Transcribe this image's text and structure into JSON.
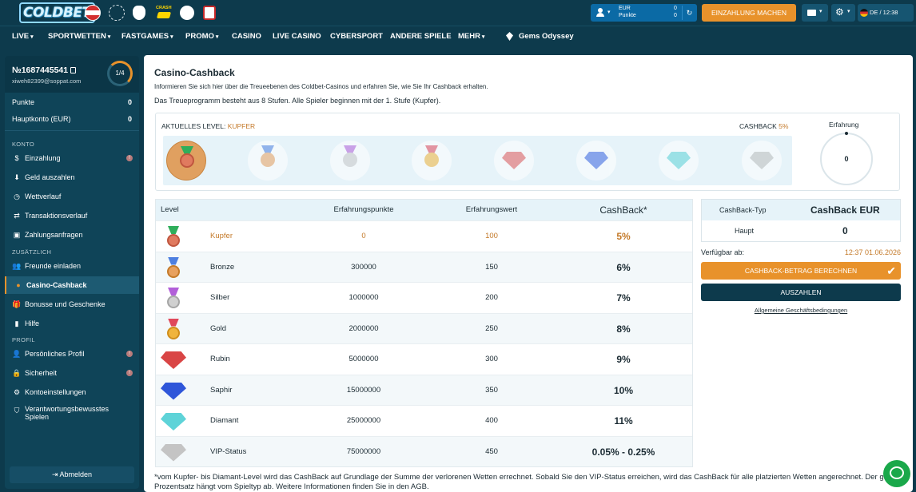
{
  "header": {
    "logo_text": "COLDBET",
    "flag_icons": [
      "austria-flag-icon",
      "champions-league-icon",
      "premier-league-icon",
      "crash-icon",
      "chicken-icon",
      "club-crest-icon"
    ],
    "crash_label": "CRASH",
    "currency": "EUR",
    "balance": "0",
    "points_label": "Punkte",
    "points": "0",
    "deposit_button": "EINZAHLUNG MACHEN",
    "lang_time": "DE / 12:38"
  },
  "nav": {
    "items": [
      "LIVE",
      "SPORTWETTEN",
      "FASTGAMES",
      "PROMO",
      "CASINO",
      "LIVE CASINO",
      "CYBERSPORT",
      "ANDERE SPIELE",
      "MEHR",
      "Gems Odyssey"
    ]
  },
  "sidebar": {
    "account_id": "№1687445541",
    "email": "xiweh82399@soppat.com",
    "level_progress": "1/4",
    "points_label": "Punkte",
    "points_value": "0",
    "main_account_label": "Hauptkonto (EUR)",
    "main_account_value": "0",
    "section_konto": "KONTO",
    "konto_items": [
      {
        "label": "Einzahlung",
        "icon": "dollar-icon",
        "badge": "!"
      },
      {
        "label": "Geld auszahlen",
        "icon": "withdraw-icon"
      },
      {
        "label": "Wettverlauf",
        "icon": "history-icon"
      },
      {
        "label": "Transaktionsverlauf",
        "icon": "transfer-icon"
      },
      {
        "label": "Zahlungsanfragen",
        "icon": "payment-requests-icon"
      }
    ],
    "section_zusaetzlich": "ZUSÄTZLICH",
    "extra_items": [
      {
        "label": "Freunde einladen",
        "icon": "friends-icon"
      },
      {
        "label": "Casino-Cashback",
        "icon": "cashback-icon",
        "active": true
      },
      {
        "label": "Bonusse und Geschenke",
        "icon": "gift-icon"
      },
      {
        "label": "Hilfe",
        "icon": "help-icon"
      }
    ],
    "section_profil": "PROFIL",
    "profile_items": [
      {
        "label": "Persönliches Profil",
        "icon": "user-icon",
        "badge": "!"
      },
      {
        "label": "Sicherheit",
        "icon": "lock-icon",
        "badge": "!"
      },
      {
        "label": "Kontoeinstellungen",
        "icon": "settings-icon"
      },
      {
        "label": "Verantwortungsbewusstes Spielen",
        "icon": "shield-icon"
      }
    ],
    "logout": "Abmelden"
  },
  "main": {
    "title": "Casino-Cashback",
    "intro": "Informieren Sie sich hier über die Treueebenen des Coldbet-Casinos und erfahren Sie, wie Sie Ihr Cashback erhalten.",
    "stages_text": "Das Treueprogramm besteht aus 8 Stufen. Alle Spieler beginnen mit der 1. Stufe (Kupfer).",
    "current_level_label": "AKTUELLES LEVEL:",
    "current_level_value": "KUPFER",
    "cashback_label": "CASHBACK",
    "cashback_value": "5%",
    "experience_label": "Erfahrung",
    "experience_value": "0",
    "table": {
      "headers": [
        "Level",
        "Erfahrungspunkte",
        "Erfahrungswert",
        "CashBack*"
      ],
      "rows": [
        {
          "level": "Kupfer",
          "points": "0",
          "value": "100",
          "cashback": "5%",
          "icon": "copper-medal-icon",
          "current": true
        },
        {
          "level": "Bronze",
          "points": "300000",
          "value": "150",
          "cashback": "6%",
          "icon": "bronze-medal-icon"
        },
        {
          "level": "Silber",
          "points": "1000000",
          "value": "200",
          "cashback": "7%",
          "icon": "silver-medal-icon"
        },
        {
          "level": "Gold",
          "points": "2000000",
          "value": "250",
          "cashback": "8%",
          "icon": "gold-medal-icon"
        },
        {
          "level": "Rubin",
          "points": "5000000",
          "value": "300",
          "cashback": "9%",
          "icon": "ruby-gem-icon"
        },
        {
          "level": "Saphir",
          "points": "15000000",
          "value": "350",
          "cashback": "10%",
          "icon": "sapphire-gem-icon"
        },
        {
          "level": "Diamant",
          "points": "25000000",
          "value": "400",
          "cashback": "11%",
          "icon": "diamond-gem-icon"
        },
        {
          "level": "VIP-Status",
          "points": "75000000",
          "value": "450",
          "cashback": "0.05% - 0.25%",
          "icon": "vip-gem-icon"
        }
      ]
    },
    "cashback_panel": {
      "type_label": "CashBack-Typ",
      "type_value": "CashBack EUR",
      "main_label": "Haupt",
      "main_value": "0",
      "available_label": "Verfügbar ab:",
      "available_value": "12:37 01.06.2026",
      "calc_button": "CASHBACK-BETRAG BERECHNEN",
      "payout_button": "AUSZAHLEN",
      "terms_link": "Allgemeine Geschäftsbedingungen"
    },
    "footnote": "*vom Kupfer- bis Diamant-Level wird das CashBack auf Grundlage der Summe der verlorenen Wetten errechnet. Sobald Sie den VIP-Status erreichen, wird das CashBack für alle platzierten Wetten angerechnet. Der genaue Prozentsatz hängt vom Spieltyp ab. Weitere Informationen finden Sie in den AGB."
  },
  "colors": {
    "orange": "#e8922b",
    "navy": "#0d3a4c",
    "sidebar": "#0f4458",
    "active": "#1d5a72"
  }
}
